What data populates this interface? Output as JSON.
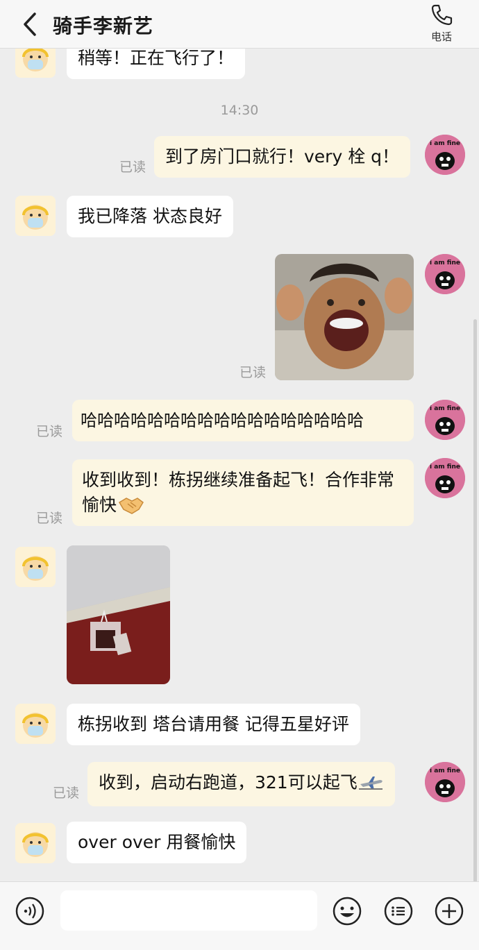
{
  "header": {
    "title": "骑手李新艺",
    "call_label": "电话"
  },
  "colors": {
    "background": "#ededed",
    "incoming_bubble": "#ffffff",
    "outgoing_bubble": "#fcf6e2",
    "read_text": "#9a9a9a",
    "my_avatar": "#d9739c"
  },
  "messages": {
    "m0": {
      "text": "稍等！正在飞行了！"
    },
    "time1": "14:30",
    "m1": {
      "text": "到了房门口就行！very 栓 q！",
      "status": "已读"
    },
    "m2": {
      "text": "我已降落 状态良好"
    },
    "m3": {
      "status": "已读"
    },
    "m4": {
      "text": "哈哈哈哈哈哈哈哈哈哈哈哈哈哈哈哈哈",
      "status": "已读"
    },
    "m5": {
      "text": "收到收到！栋拐继续准备起飞！合作非常愉快",
      "status": "已读"
    },
    "m7": {
      "text": "栋拐收到 塔台请用餐  记得五星好评"
    },
    "m8": {
      "text": "收到，启动右跑道，321可以起飞",
      "status": "已读"
    },
    "m9": {
      "text": "over over 用餐愉快"
    }
  },
  "my_avatar_text": "i am fine",
  "icons": {
    "back": "chevron-left-icon",
    "call": "phone-icon",
    "voice": "voice-icon",
    "emoji": "emoji-icon",
    "menu": "list-icon",
    "plus": "plus-icon",
    "handshake": "handshake-emoji",
    "airplane": "airplane-emoji"
  }
}
